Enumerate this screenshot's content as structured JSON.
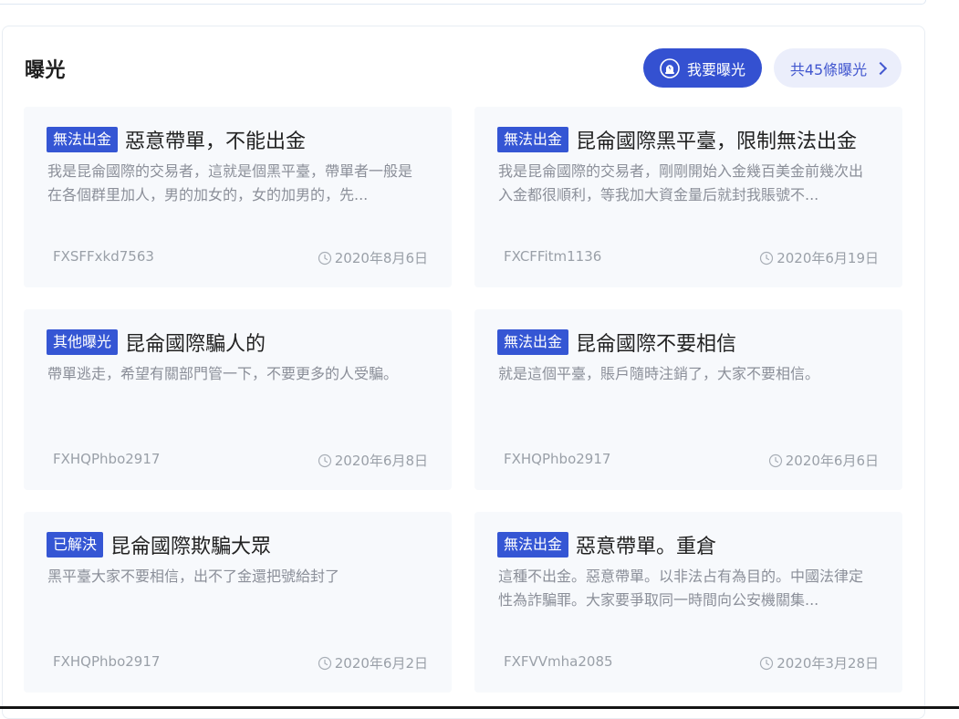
{
  "section": {
    "title": "曝光"
  },
  "actions": {
    "expose_label": "我要曝光",
    "expose_icon": "alarm-light-icon",
    "total_label": "共45條曝光",
    "total_icon": "chevron-right-icon"
  },
  "colors": {
    "accent": "#3451d1",
    "accent_soft": "#ebeefb",
    "tag_bg": "#3556d4",
    "card_bg": "#f7f9fc",
    "muted_text": "#8b8f99"
  },
  "cards": [
    {
      "tag": "無法出金",
      "title": "惡意帶單，不能出金",
      "description": "我是昆侖國際的交易者，這就是個黑平臺，帶單者一般是在各個群里加人，男的加女的，女的加男的，先...",
      "user": "FXSFFxkd7563",
      "date": "2020年8月6日"
    },
    {
      "tag": "無法出金",
      "title": "昆侖國際黑平臺，限制無法出金",
      "description": "我是昆侖國際的交易者，剛剛開始入金幾百美金前幾次出入金都很順利，等我加大資金量后就封我賬號不...",
      "user": "FXCFFitm1136",
      "date": "2020年6月19日"
    },
    {
      "tag": "其他曝光",
      "title": "昆侖國際騙人的",
      "description": "帶單逃走，希望有關部門管一下，不要更多的人受騙。",
      "user": "FXHQPhbo2917",
      "date": "2020年6月8日"
    },
    {
      "tag": "無法出金",
      "title": "昆侖國際不要相信",
      "description": "就是這個平臺，賬戶隨時注銷了，大家不要相信。",
      "user": "FXHQPhbo2917",
      "date": "2020年6月6日"
    },
    {
      "tag": "已解決",
      "title": "昆侖國際欺騙大眾",
      "description": "黑平臺大家不要相信，出不了金還把號給封了",
      "user": "FXHQPhbo2917",
      "date": "2020年6月2日"
    },
    {
      "tag": "無法出金",
      "title": "惡意帶單。重倉",
      "description": "這種不出金。惡意帶單。以非法占有為目的。中國法律定性為詐騙罪。大家要爭取同一時間向公安機關集...",
      "user": "FXFVVmha2085",
      "date": "2020年3月28日"
    }
  ]
}
